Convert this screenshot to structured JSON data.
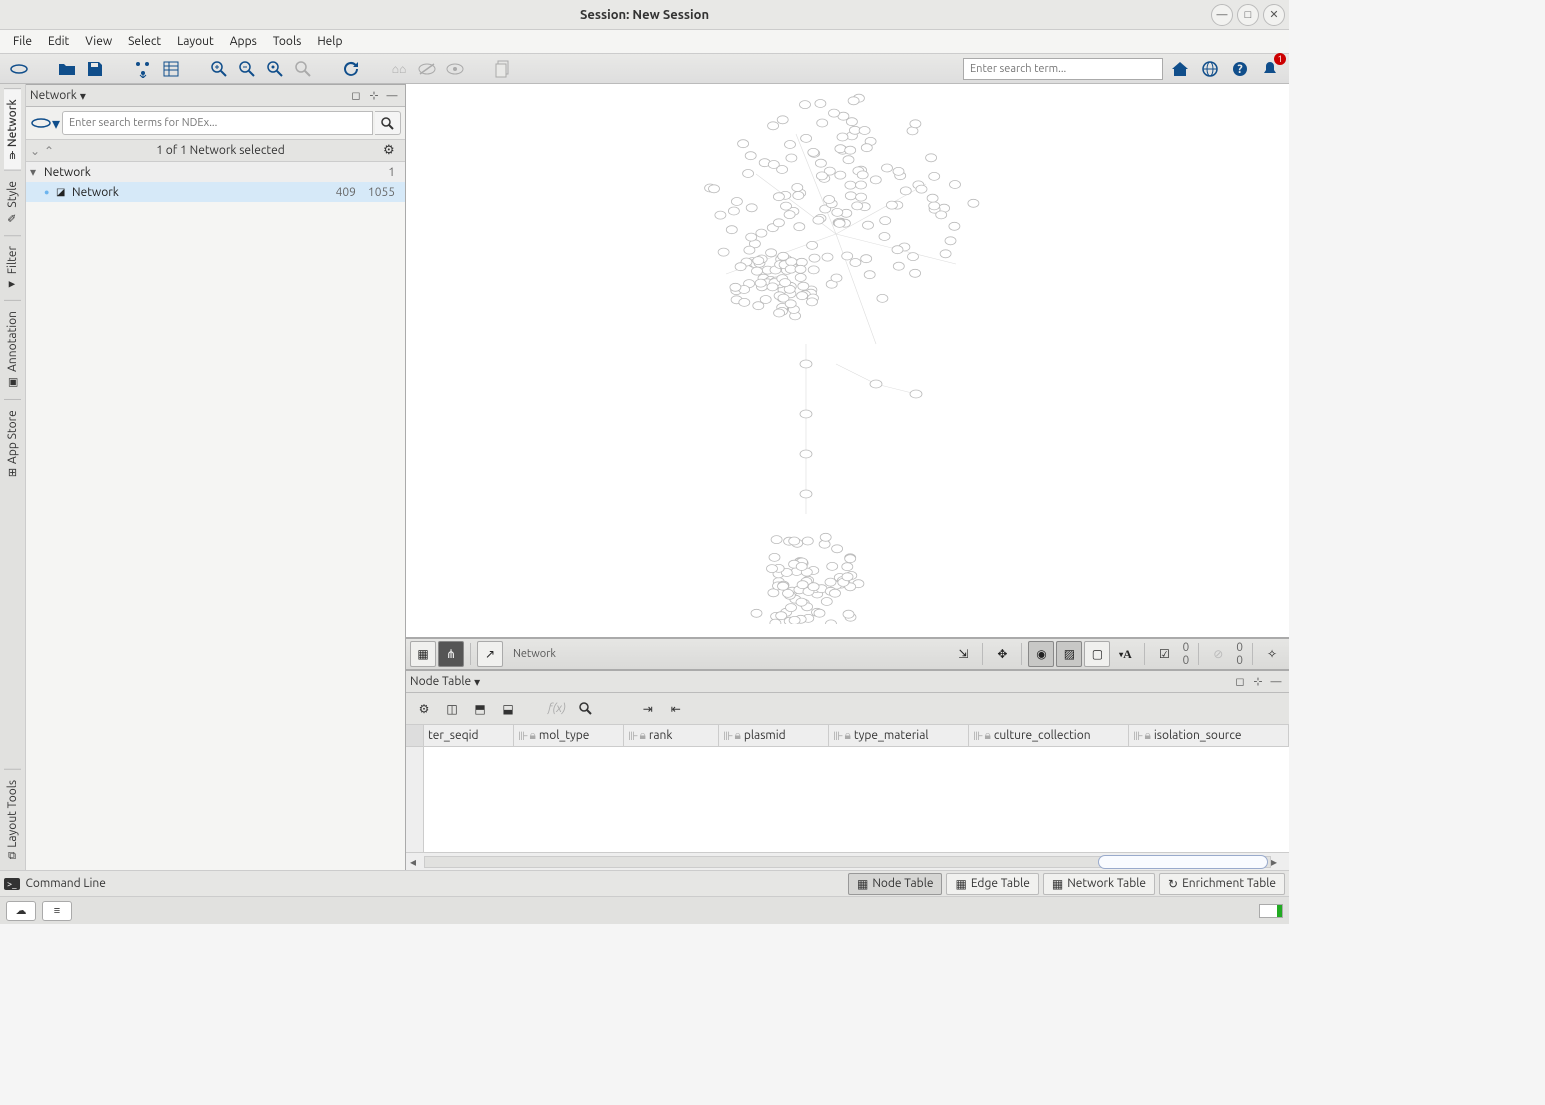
{
  "window": {
    "title": "Session: New Session"
  },
  "menubar": [
    "File",
    "Edit",
    "View",
    "Select",
    "Layout",
    "Apps",
    "Tools",
    "Help"
  ],
  "toolbar_search_placeholder": "Enter search term...",
  "notification_badge": "1",
  "sidetabs": [
    "Network",
    "Style",
    "Filter",
    "Annotation",
    "App Store",
    "Layout Tools"
  ],
  "network_panel": {
    "title": "Network",
    "ndex_placeholder": "Enter search terms for NDEx...",
    "selection_status": "1 of 1 Network selected",
    "root": {
      "name": "Network",
      "count": "1"
    },
    "item": {
      "name": "Network",
      "nodes": "409",
      "edges": "1055"
    }
  },
  "graph_bar": {
    "label": "Network"
  },
  "counters": {
    "a1": "0",
    "a2": "0",
    "b1": "0",
    "b2": "0"
  },
  "node_table": {
    "title": "Node Table",
    "columns": [
      "ter_seqid",
      "mol_type",
      "rank",
      "plasmid",
      "type_material",
      "culture_collection",
      "isolation_source"
    ]
  },
  "status_tabs": [
    "Node Table",
    "Edge Table",
    "Network Table",
    "Enrichment Table"
  ],
  "status_left": "Command Line"
}
